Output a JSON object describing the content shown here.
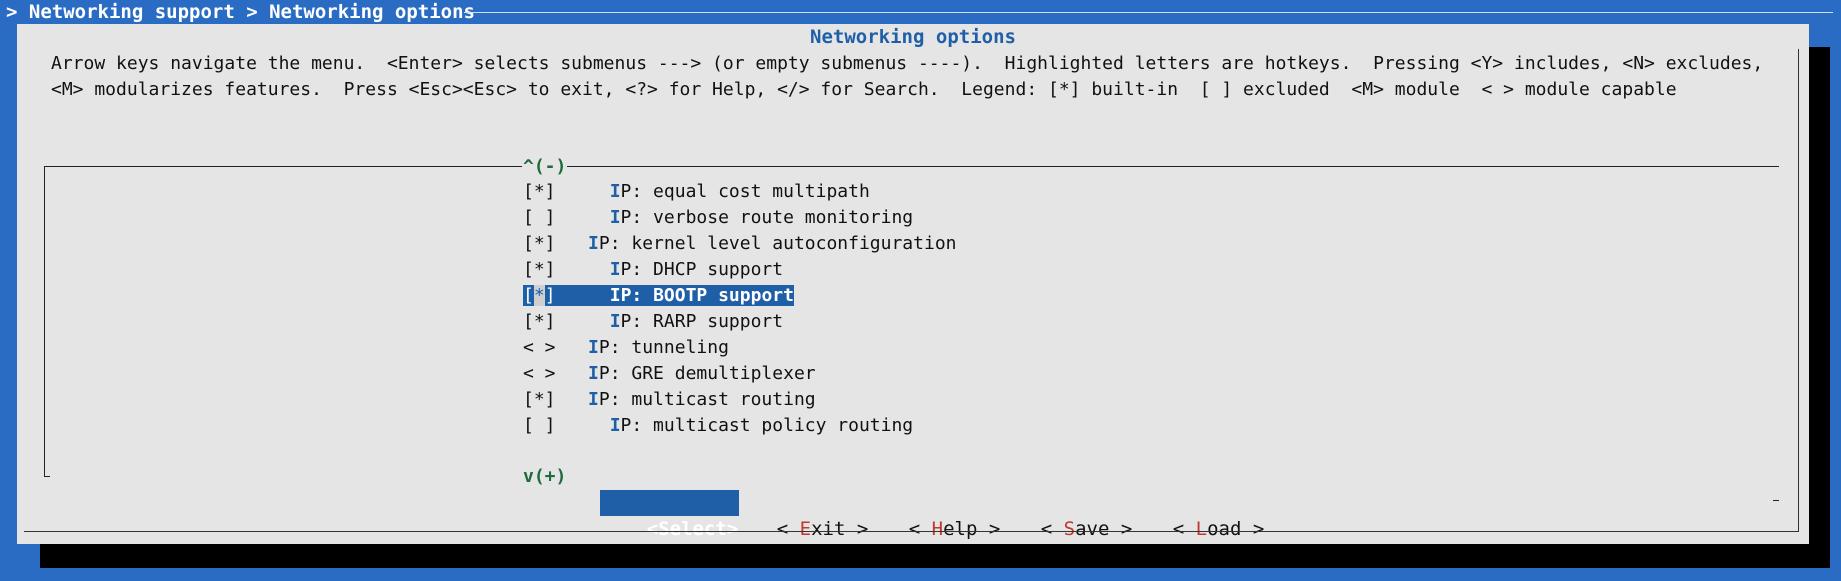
{
  "breadcrumb": "> Networking support > Networking options",
  "dialog": {
    "title": "Networking options",
    "help_line_1": "Arrow keys navigate the menu.  <Enter> selects submenus ---> (or empty submenus ----).  Highlighted letters are hotkeys.  Pressing <Y> includes, <N> excludes,",
    "help_line_2": "<M> modularizes features.  Press <Esc><Esc> to exit, <?> for Help, </> for Search.  Legend: [*] built-in  [ ] excluded  <M> module  < > module capable"
  },
  "scroll": {
    "up": "^(-)",
    "down": "v(+)"
  },
  "menu_items": [
    {
      "state": "[*]",
      "indent": "    ",
      "hot": "I",
      "rest": "P: equal cost multipath"
    },
    {
      "state": "[ ]",
      "indent": "    ",
      "hot": "I",
      "rest": "P: verbose route monitoring"
    },
    {
      "state": "[*]",
      "indent": "  ",
      "hot": "I",
      "rest": "P: kernel level autoconfiguration"
    },
    {
      "state": "[*]",
      "indent": "    ",
      "hot": "I",
      "rest": "P: DHCP support"
    },
    {
      "state": "[*]",
      "indent": "    ",
      "hot": "I",
      "rest": "P: BOOTP support",
      "selected": true
    },
    {
      "state": "[*]",
      "indent": "    ",
      "hot": "I",
      "rest": "P: RARP support"
    },
    {
      "state": "< >",
      "indent": "  ",
      "hot": "I",
      "rest": "P: tunneling"
    },
    {
      "state": "< >",
      "indent": "  ",
      "hot": "I",
      "rest": "P: GRE demultiplexer"
    },
    {
      "state": "[*]",
      "indent": "  ",
      "hot": "I",
      "rest": "P: multicast routing"
    },
    {
      "state": "[ ]",
      "indent": "    ",
      "hot": "I",
      "rest": "P: multicast policy routing"
    }
  ],
  "buttons": {
    "select": {
      "open": "<",
      "hot": "S",
      "rest": "elect",
      "close": ">"
    },
    "exit": {
      "open": "< ",
      "hot": "E",
      "rest": "xit",
      "close": " >"
    },
    "help": {
      "open": "< ",
      "hot": "H",
      "rest": "elp",
      "close": " >"
    },
    "save": {
      "open": "< ",
      "hot": "S",
      "rest": "ave",
      "close": " >"
    },
    "load": {
      "open": "< ",
      "hot": "L",
      "rest": "oad",
      "close": " >"
    }
  },
  "colors": {
    "background": "#2a6cc4",
    "dialog": "#e5e5e5",
    "highlight": "#1f5fa8",
    "hotkey_button": "#c0392b",
    "scroll_indicator": "#1e6b3c"
  }
}
